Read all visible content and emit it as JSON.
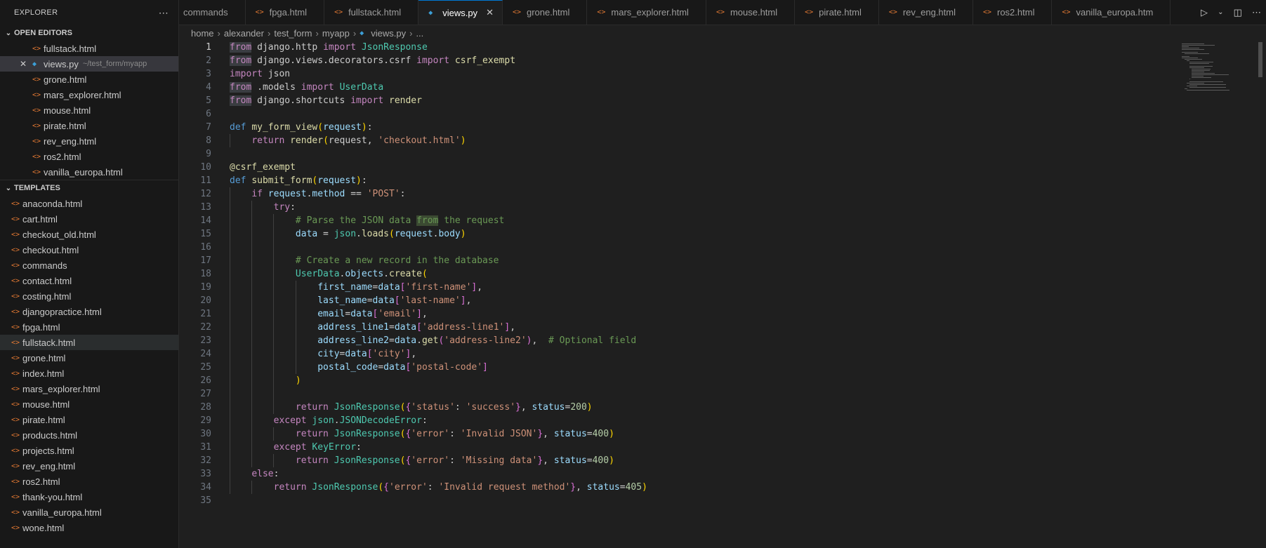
{
  "explorer": {
    "title": "EXPLORER",
    "open_editors_title": "OPEN EDITORS",
    "templates_title": "TEMPLATES",
    "open_editors": [
      {
        "name": "fullstack.html",
        "type": "html"
      },
      {
        "name": "views.py",
        "type": "py",
        "desc": "~/test_form/myapp",
        "active": true
      },
      {
        "name": "grone.html",
        "type": "html"
      },
      {
        "name": "mars_explorer.html",
        "type": "html"
      },
      {
        "name": "mouse.html",
        "type": "html"
      },
      {
        "name": "pirate.html",
        "type": "html"
      },
      {
        "name": "rev_eng.html",
        "type": "html"
      },
      {
        "name": "ros2.html",
        "type": "html"
      },
      {
        "name": "vanilla_europa.html",
        "type": "html"
      }
    ],
    "templates": [
      {
        "name": "anaconda.html"
      },
      {
        "name": "cart.html"
      },
      {
        "name": "checkout_old.html"
      },
      {
        "name": "checkout.html"
      },
      {
        "name": "commands"
      },
      {
        "name": "contact.html"
      },
      {
        "name": "costing.html"
      },
      {
        "name": "djangopractice.html"
      },
      {
        "name": "fpga.html"
      },
      {
        "name": "fullstack.html",
        "selected": true
      },
      {
        "name": "grone.html"
      },
      {
        "name": "index.html"
      },
      {
        "name": "mars_explorer.html"
      },
      {
        "name": "mouse.html"
      },
      {
        "name": "pirate.html"
      },
      {
        "name": "products.html"
      },
      {
        "name": "projects.html"
      },
      {
        "name": "rev_eng.html"
      },
      {
        "name": "ros2.html"
      },
      {
        "name": "thank-you.html"
      },
      {
        "name": "vanilla_europa.html"
      },
      {
        "name": "wone.html"
      }
    ]
  },
  "tabs": [
    {
      "label": "commands",
      "type": "none"
    },
    {
      "label": "fpga.html",
      "type": "html"
    },
    {
      "label": "fullstack.html",
      "type": "html"
    },
    {
      "label": "views.py",
      "type": "py",
      "active": true
    },
    {
      "label": "grone.html",
      "type": "html"
    },
    {
      "label": "mars_explorer.html",
      "type": "html"
    },
    {
      "label": "mouse.html",
      "type": "html"
    },
    {
      "label": "pirate.html",
      "type": "html"
    },
    {
      "label": "rev_eng.html",
      "type": "html"
    },
    {
      "label": "ros2.html",
      "type": "html"
    },
    {
      "label": "vanilla_europa.htm",
      "type": "html"
    }
  ],
  "breadcrumb": [
    "home",
    "alexander",
    "test_form",
    "myapp",
    "views.py",
    "..."
  ],
  "editor": {
    "current_line": 1,
    "lines": [
      [
        [
          "from",
          "k hl"
        ],
        [
          " django.http ",
          ""
        ],
        [
          "import",
          "k"
        ],
        [
          " ",
          ""
        ],
        [
          "JsonResponse",
          "t"
        ]
      ],
      [
        [
          "from",
          "k hl"
        ],
        [
          " django.views.decorators.csrf ",
          ""
        ],
        [
          "import",
          "k"
        ],
        [
          " ",
          ""
        ],
        [
          "csrf_exempt",
          "f"
        ]
      ],
      [
        [
          "import",
          "k"
        ],
        [
          " json",
          ""
        ]
      ],
      [
        [
          "from",
          "k hl"
        ],
        [
          " .models ",
          ""
        ],
        [
          "import",
          "k"
        ],
        [
          " ",
          ""
        ],
        [
          "UserData",
          "t"
        ]
      ],
      [
        [
          "from",
          "k hl"
        ],
        [
          " django.shortcuts ",
          ""
        ],
        [
          "import",
          "k"
        ],
        [
          " ",
          ""
        ],
        [
          "render",
          "f"
        ]
      ],
      [],
      [
        [
          "def",
          "kd"
        ],
        [
          " ",
          ""
        ],
        [
          "my_form_view",
          "f"
        ],
        [
          "(",
          "b1"
        ],
        [
          "request",
          "v"
        ],
        [
          ")",
          "b1"
        ],
        [
          ":",
          ""
        ]
      ],
      [
        [
          "    ",
          ""
        ],
        [
          "return",
          "k"
        ],
        [
          " ",
          ""
        ],
        [
          "render",
          "f"
        ],
        [
          "(",
          "b1"
        ],
        [
          "request",
          ""
        ],
        [
          ", ",
          ""
        ],
        [
          "'checkout.html'",
          "s"
        ],
        [
          ")",
          "b1"
        ]
      ],
      [],
      [
        [
          "@csrf_exempt",
          "f"
        ]
      ],
      [
        [
          "def",
          "kd"
        ],
        [
          " ",
          ""
        ],
        [
          "submit_form",
          "f"
        ],
        [
          "(",
          "b1"
        ],
        [
          "request",
          "v"
        ],
        [
          ")",
          "b1"
        ],
        [
          ":",
          ""
        ]
      ],
      [
        [
          "    ",
          ""
        ],
        [
          "if",
          "k"
        ],
        [
          " ",
          ""
        ],
        [
          "request",
          "v"
        ],
        [
          ".",
          ""
        ],
        [
          "method",
          "v"
        ],
        [
          " == ",
          ""
        ],
        [
          "'POST'",
          "s"
        ],
        [
          ":",
          ""
        ]
      ],
      [
        [
          "        ",
          ""
        ],
        [
          "try",
          "k"
        ],
        [
          ":",
          ""
        ]
      ],
      [
        [
          "            ",
          ""
        ],
        [
          "# Parse the JSON data ",
          "c"
        ],
        [
          "from",
          "c hlc"
        ],
        [
          " the request",
          "c"
        ]
      ],
      [
        [
          "            ",
          ""
        ],
        [
          "data",
          "v"
        ],
        [
          " = ",
          ""
        ],
        [
          "json",
          "t"
        ],
        [
          ".",
          ""
        ],
        [
          "loads",
          "f"
        ],
        [
          "(",
          "b1"
        ],
        [
          "request",
          "v"
        ],
        [
          ".",
          ""
        ],
        [
          "body",
          "v"
        ],
        [
          ")",
          "b1"
        ]
      ],
      [],
      [
        [
          "            ",
          ""
        ],
        [
          "# Create a new record in the database",
          "c"
        ]
      ],
      [
        [
          "            ",
          ""
        ],
        [
          "UserData",
          "t"
        ],
        [
          ".",
          ""
        ],
        [
          "objects",
          "v"
        ],
        [
          ".",
          ""
        ],
        [
          "create",
          "f"
        ],
        [
          "(",
          "b1"
        ]
      ],
      [
        [
          "                ",
          ""
        ],
        [
          "first_name",
          "v"
        ],
        [
          "=",
          ""
        ],
        [
          "data",
          "v"
        ],
        [
          "[",
          "b2"
        ],
        [
          "'first-name'",
          "s"
        ],
        [
          "]",
          "b2"
        ],
        [
          ",",
          ""
        ]
      ],
      [
        [
          "                ",
          ""
        ],
        [
          "last_name",
          "v"
        ],
        [
          "=",
          ""
        ],
        [
          "data",
          "v"
        ],
        [
          "[",
          "b2"
        ],
        [
          "'last-name'",
          "s"
        ],
        [
          "]",
          "b2"
        ],
        [
          ",",
          ""
        ]
      ],
      [
        [
          "                ",
          ""
        ],
        [
          "email",
          "v"
        ],
        [
          "=",
          ""
        ],
        [
          "data",
          "v"
        ],
        [
          "[",
          "b2"
        ],
        [
          "'email'",
          "s"
        ],
        [
          "]",
          "b2"
        ],
        [
          ",",
          ""
        ]
      ],
      [
        [
          "                ",
          ""
        ],
        [
          "address_line1",
          "v"
        ],
        [
          "=",
          ""
        ],
        [
          "data",
          "v"
        ],
        [
          "[",
          "b2"
        ],
        [
          "'address-line1'",
          "s"
        ],
        [
          "]",
          "b2"
        ],
        [
          ",",
          ""
        ]
      ],
      [
        [
          "                ",
          ""
        ],
        [
          "address_line2",
          "v"
        ],
        [
          "=",
          ""
        ],
        [
          "data",
          "v"
        ],
        [
          ".",
          ""
        ],
        [
          "get",
          "f"
        ],
        [
          "(",
          "b2"
        ],
        [
          "'address-line2'",
          "s"
        ],
        [
          ")",
          "b2"
        ],
        [
          ",  ",
          ""
        ],
        [
          "# Optional field",
          "c"
        ]
      ],
      [
        [
          "                ",
          ""
        ],
        [
          "city",
          "v"
        ],
        [
          "=",
          ""
        ],
        [
          "data",
          "v"
        ],
        [
          "[",
          "b2"
        ],
        [
          "'city'",
          "s"
        ],
        [
          "]",
          "b2"
        ],
        [
          ",",
          ""
        ]
      ],
      [
        [
          "                ",
          ""
        ],
        [
          "postal_code",
          "v"
        ],
        [
          "=",
          ""
        ],
        [
          "data",
          "v"
        ],
        [
          "[",
          "b2"
        ],
        [
          "'postal-code'",
          "s"
        ],
        [
          "]",
          "b2"
        ]
      ],
      [
        [
          "            ",
          ""
        ],
        [
          ")",
          "b1"
        ]
      ],
      [],
      [
        [
          "            ",
          ""
        ],
        [
          "return",
          "k"
        ],
        [
          " ",
          ""
        ],
        [
          "JsonResponse",
          "t"
        ],
        [
          "(",
          "b1"
        ],
        [
          "{",
          "b2"
        ],
        [
          "'status'",
          "s"
        ],
        [
          ": ",
          ""
        ],
        [
          "'success'",
          "s"
        ],
        [
          "}",
          "b2"
        ],
        [
          ", ",
          ""
        ],
        [
          "status",
          "v"
        ],
        [
          "=",
          ""
        ],
        [
          "200",
          "n"
        ],
        [
          ")",
          "b1"
        ]
      ],
      [
        [
          "        ",
          ""
        ],
        [
          "except",
          "k"
        ],
        [
          " ",
          ""
        ],
        [
          "json",
          "t"
        ],
        [
          ".",
          ""
        ],
        [
          "JSONDecodeError",
          "t"
        ],
        [
          ":",
          ""
        ]
      ],
      [
        [
          "            ",
          ""
        ],
        [
          "return",
          "k"
        ],
        [
          " ",
          ""
        ],
        [
          "JsonResponse",
          "t"
        ],
        [
          "(",
          "b1"
        ],
        [
          "{",
          "b2"
        ],
        [
          "'error'",
          "s"
        ],
        [
          ": ",
          ""
        ],
        [
          "'Invalid JSON'",
          "s"
        ],
        [
          "}",
          "b2"
        ],
        [
          ", ",
          ""
        ],
        [
          "status",
          "v"
        ],
        [
          "=",
          ""
        ],
        [
          "400",
          "n"
        ],
        [
          ")",
          "b1"
        ]
      ],
      [
        [
          "        ",
          ""
        ],
        [
          "except",
          "k"
        ],
        [
          " ",
          ""
        ],
        [
          "KeyError",
          "t"
        ],
        [
          ":",
          ""
        ]
      ],
      [
        [
          "            ",
          ""
        ],
        [
          "return",
          "k"
        ],
        [
          " ",
          ""
        ],
        [
          "JsonResponse",
          "t"
        ],
        [
          "(",
          "b1"
        ],
        [
          "{",
          "b2"
        ],
        [
          "'error'",
          "s"
        ],
        [
          ": ",
          ""
        ],
        [
          "'Missing data'",
          "s"
        ],
        [
          "}",
          "b2"
        ],
        [
          ", ",
          ""
        ],
        [
          "status",
          "v"
        ],
        [
          "=",
          ""
        ],
        [
          "400",
          "n"
        ],
        [
          ")",
          "b1"
        ]
      ],
      [
        [
          "    ",
          ""
        ],
        [
          "else",
          "k"
        ],
        [
          ":",
          ""
        ]
      ],
      [
        [
          "        ",
          ""
        ],
        [
          "return",
          "k"
        ],
        [
          " ",
          ""
        ],
        [
          "JsonResponse",
          "t"
        ],
        [
          "(",
          "b1"
        ],
        [
          "{",
          "b2"
        ],
        [
          "'error'",
          "s"
        ],
        [
          ": ",
          ""
        ],
        [
          "'Invalid request method'",
          "s"
        ],
        [
          "}",
          "b2"
        ],
        [
          ", ",
          ""
        ],
        [
          "status",
          "v"
        ],
        [
          "=",
          ""
        ],
        [
          "405",
          "n"
        ],
        [
          ")",
          "b1"
        ]
      ],
      []
    ]
  }
}
